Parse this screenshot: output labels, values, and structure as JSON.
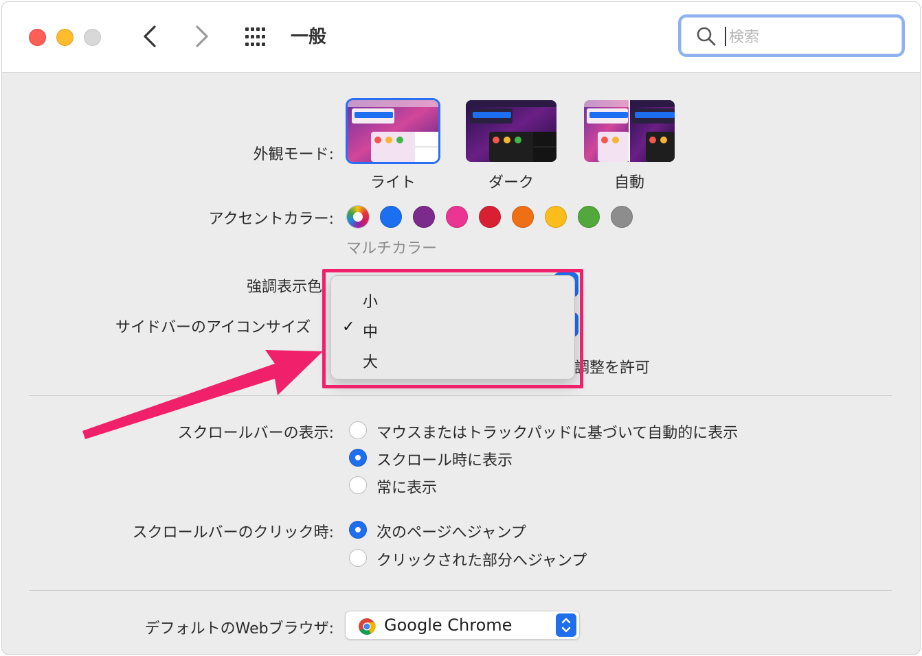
{
  "window": {
    "title": "一般",
    "search": {
      "placeholder": "検索",
      "value": ""
    }
  },
  "appearance": {
    "label": "外観モード:",
    "options": [
      {
        "label": "ライト",
        "selected": true
      },
      {
        "label": "ダーク",
        "selected": false
      },
      {
        "label": "自動",
        "selected": false
      }
    ]
  },
  "accent": {
    "label": "アクセントカラー:",
    "note": "マルチカラー",
    "colors": [
      "multicolor",
      "#1b6ff0",
      "#7c2a8c",
      "#ea3592",
      "#d92033",
      "#ef6f17",
      "#fbbd1c",
      "#52a83b",
      "#8d8d8d"
    ]
  },
  "highlight": {
    "label": "強調表示色"
  },
  "sidebar_icon_size": {
    "label": "サイドバーのアイコンサイズ",
    "menu": [
      {
        "label": "小",
        "checked": false
      },
      {
        "label": "中",
        "checked": true
      },
      {
        "label": "大",
        "checked": false
      }
    ]
  },
  "wallpaper_tinting": {
    "label_partial": "調整を許可"
  },
  "scroll_bars": {
    "label": "スクロールバーの表示:",
    "options": [
      {
        "label": "マウスまたはトラックパッドに基づいて自動的に表示",
        "selected": false
      },
      {
        "label": "スクロール時に表示",
        "selected": true
      },
      {
        "label": "常に表示",
        "selected": false
      }
    ]
  },
  "scroll_click": {
    "label": "スクロールバーのクリック時:",
    "options": [
      {
        "label": "次のページへジャンプ",
        "selected": true
      },
      {
        "label": "クリックされた部分へジャンプ",
        "selected": false
      }
    ]
  },
  "default_browser": {
    "label": "デフォルトのWebブラウザ:",
    "value": "Google Chrome",
    "icon": "chrome-icon"
  },
  "annotation": {
    "color": "#f0216a"
  }
}
